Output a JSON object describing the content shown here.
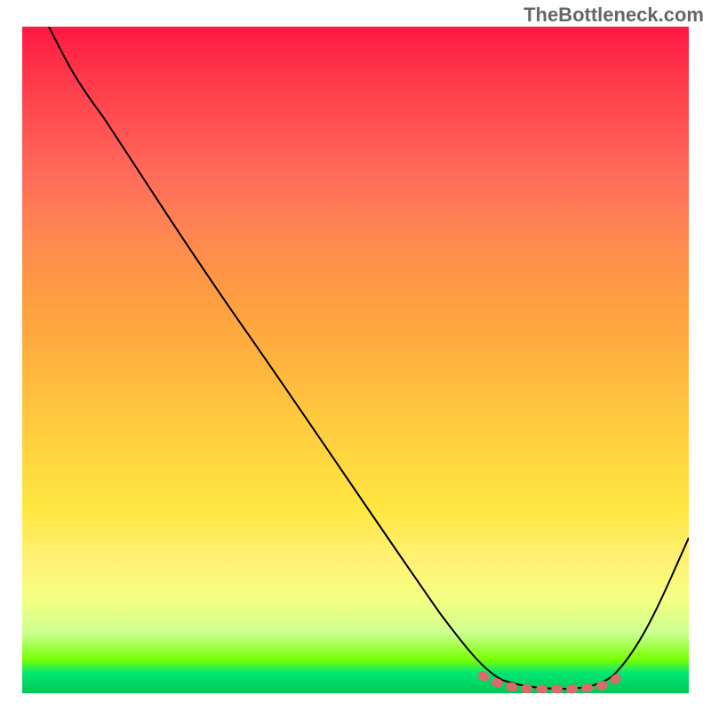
{
  "watermark": "TheBottleneck.com",
  "chart_data": {
    "type": "line",
    "title": "",
    "xlabel": "",
    "ylabel": "",
    "xlim": [
      0,
      100
    ],
    "ylim": [
      0,
      100
    ],
    "curve_points": [
      {
        "x": 4,
        "y": 100
      },
      {
        "x": 8,
        "y": 93
      },
      {
        "x": 13,
        "y": 86
      },
      {
        "x": 22,
        "y": 72
      },
      {
        "x": 35,
        "y": 52
      },
      {
        "x": 50,
        "y": 30
      },
      {
        "x": 60,
        "y": 15
      },
      {
        "x": 67,
        "y": 5
      },
      {
        "x": 70,
        "y": 2
      },
      {
        "x": 74,
        "y": 0.5
      },
      {
        "x": 80,
        "y": 0.5
      },
      {
        "x": 85,
        "y": 0.5
      },
      {
        "x": 88,
        "y": 2
      },
      {
        "x": 92,
        "y": 8
      },
      {
        "x": 97,
        "y": 18
      },
      {
        "x": 100,
        "y": 24
      }
    ],
    "highlight_region": {
      "x_start": 69,
      "x_end": 88,
      "color": "#d96b6b"
    },
    "description": "V-shaped bottleneck curve descending from top-left to minimum near x=78, then rising toward right. Minimum region highlighted with thick salmon-colored dashed segment."
  }
}
